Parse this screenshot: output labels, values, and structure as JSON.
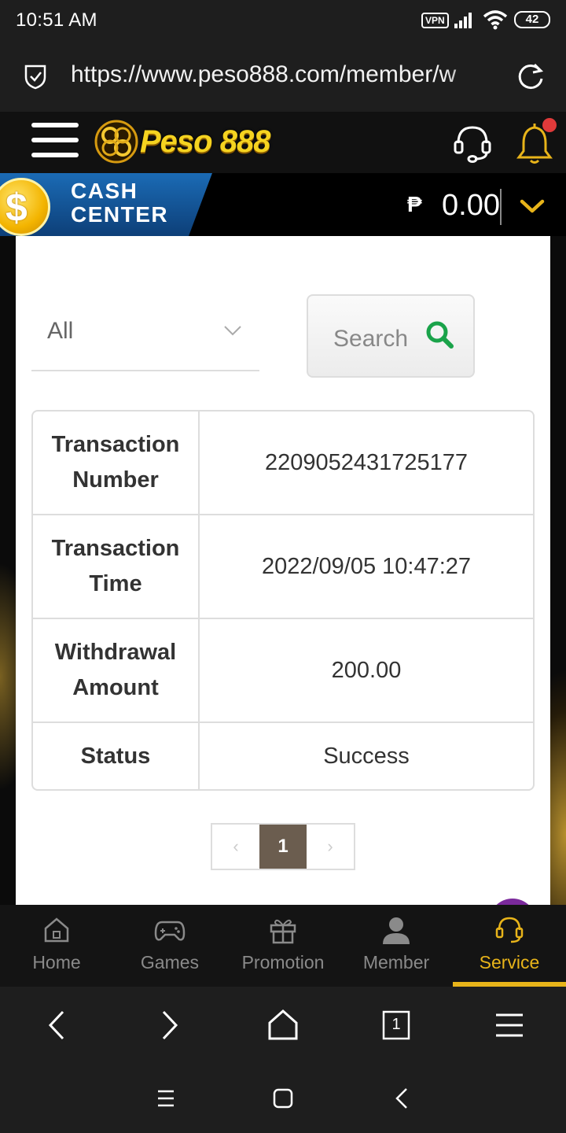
{
  "status_bar": {
    "time": "10:51 AM",
    "vpn": "VPN",
    "battery": "42"
  },
  "browser": {
    "url": "https://www.peso888.com/member/w"
  },
  "site": {
    "logo_text": "Peso 888"
  },
  "cash_center": {
    "title_line1": "CASH",
    "title_line2": "CENTER",
    "currency_symbol": "₱",
    "balance": "0.00"
  },
  "filter": {
    "selected": "All"
  },
  "search": {
    "label": "Search"
  },
  "transaction": {
    "rows": [
      {
        "label_line1": "Transaction",
        "label_line2": "Number",
        "value": "2209052431725177"
      },
      {
        "label_line1": "Transaction",
        "label_line2": "Time",
        "value": "2022/09/05 10:47:27"
      },
      {
        "label_line1": "Withdrawal",
        "label_line2": "Amount",
        "value": "200.00"
      },
      {
        "label_line1": "Status",
        "label_line2": "",
        "value": "Success"
      }
    ]
  },
  "pagination": {
    "prev": "‹",
    "current": "1",
    "next": "›"
  },
  "bottom_nav": [
    {
      "label": "Home",
      "icon": "home-icon",
      "active": false
    },
    {
      "label": "Games",
      "icon": "gamepad-icon",
      "active": false
    },
    {
      "label": "Promotion",
      "icon": "gift-icon",
      "active": false
    },
    {
      "label": "Member",
      "icon": "user-icon",
      "active": false
    },
    {
      "label": "Service",
      "icon": "headset-icon",
      "active": true
    }
  ],
  "browser_nav": {
    "tab_count": "1"
  },
  "colors": {
    "accent_gold": "#e8b41a",
    "cash_blue": "#1b6bb5",
    "search_green": "#1aa34a",
    "page_current": "#6b5d4f"
  }
}
